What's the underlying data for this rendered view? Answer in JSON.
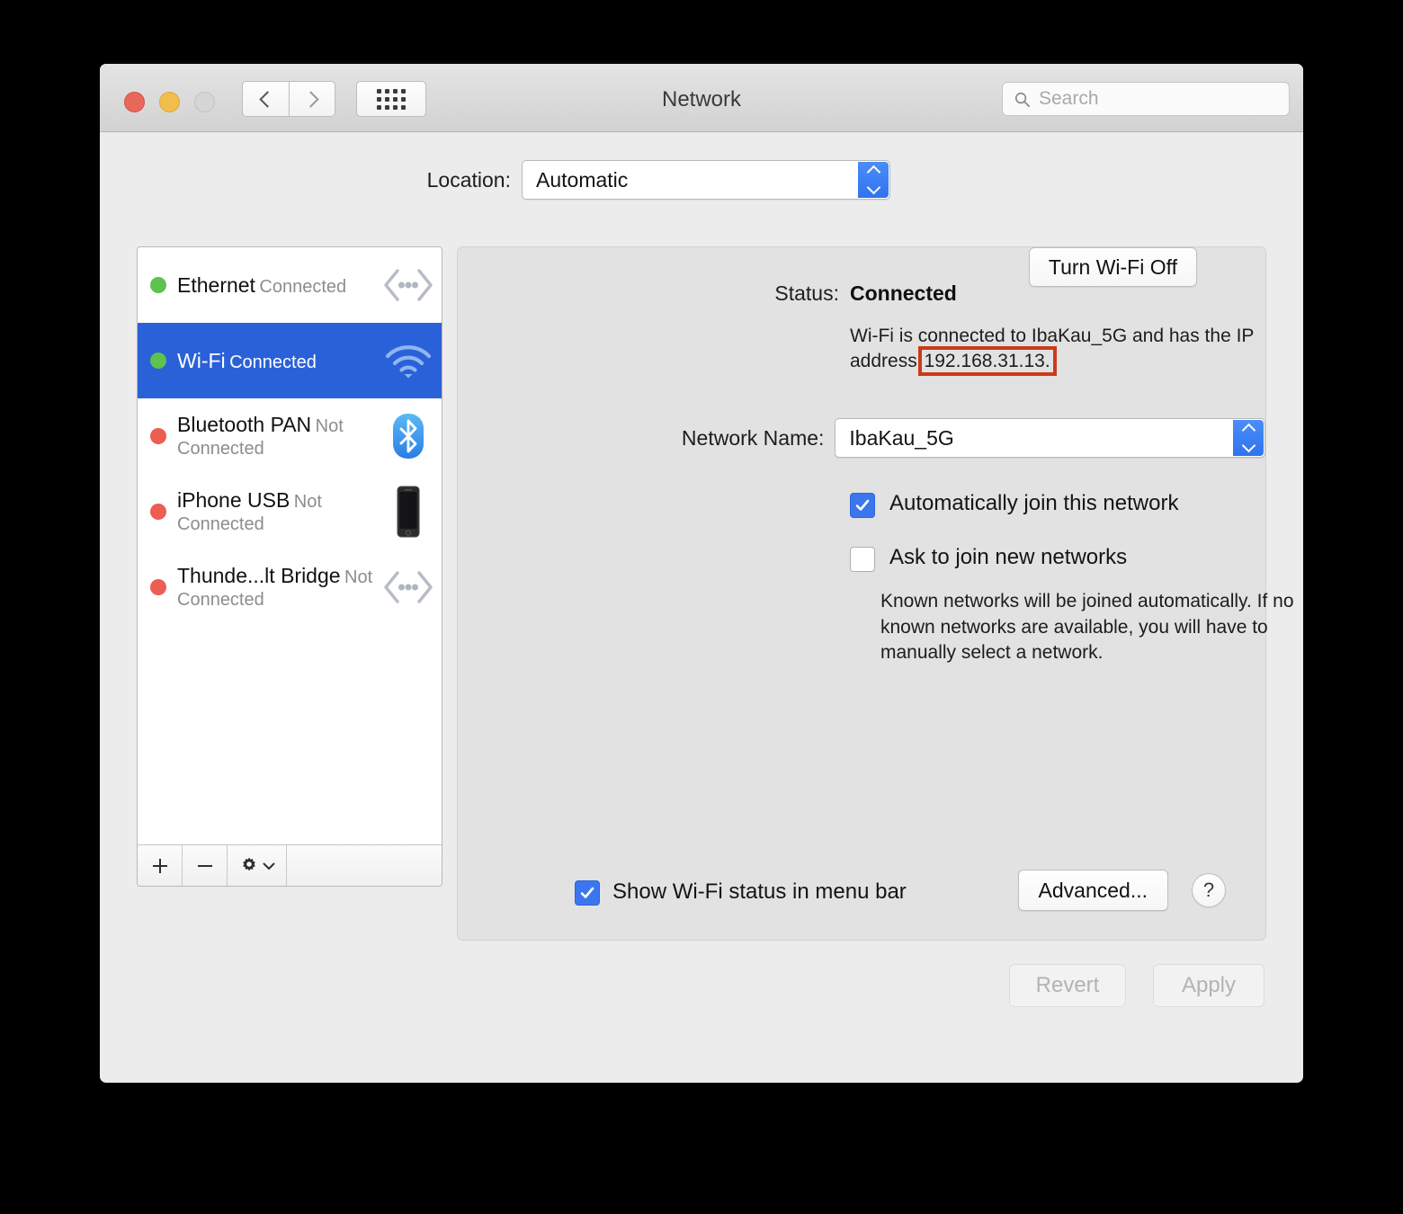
{
  "window": {
    "title": "Network",
    "traffic_lights": [
      "close",
      "minimize",
      "zoom"
    ]
  },
  "toolbar": {
    "back_icon": "chevron-left-icon",
    "forward_icon": "chevron-right-icon",
    "grid_icon": "show-all-grid-icon",
    "search": {
      "placeholder": "Search",
      "value": "",
      "icon": "search-icon"
    }
  },
  "location": {
    "label": "Location:",
    "value": "Automatic",
    "options": [
      "Automatic"
    ]
  },
  "sidebar": {
    "interfaces": [
      {
        "name": "Ethernet",
        "status": "Connected",
        "dot": "green",
        "icon": "ethernet-icon",
        "selected": false
      },
      {
        "name": "Wi-Fi",
        "status": "Connected",
        "dot": "green",
        "icon": "wifi-icon",
        "selected": true
      },
      {
        "name": "Bluetooth PAN",
        "status": "Not Connected",
        "dot": "red",
        "icon": "bluetooth-icon",
        "selected": false
      },
      {
        "name": "iPhone USB",
        "status": "Not Connected",
        "dot": "red",
        "icon": "iphone-icon",
        "selected": false
      },
      {
        "name": "Thunde...lt Bridge",
        "status": "Not Connected",
        "dot": "red",
        "icon": "ethernet-icon",
        "selected": false
      }
    ],
    "toolbar": {
      "add_label": "+",
      "remove_label": "−",
      "gear_icon": "gear-icon",
      "gear_chevron_icon": "chevron-down-icon"
    }
  },
  "panel": {
    "status_label": "Status:",
    "status_value": "Connected",
    "turn_wifi_off_label": "Turn Wi-Fi Off",
    "status_description_before": "Wi-Fi is connected to IbaKau_5G and has the IP address ",
    "status_ip": "192.168.31.13.",
    "network_name_label": "Network Name:",
    "network_name_value": "IbaKau_5G",
    "auto_join_label": "Automatically join this network",
    "auto_join_checked": true,
    "ask_join_label": "Ask to join new networks",
    "ask_join_checked": false,
    "known_networks_note": "Known networks will be joined automatically. If no known networks are available, you will have to manually select a network.",
    "show_status_label": "Show Wi-Fi status in menu bar",
    "show_status_checked": true,
    "advanced_label": "Advanced...",
    "help_label": "?"
  },
  "footer": {
    "revert_label": "Revert",
    "apply_label": "Apply",
    "revert_enabled": false,
    "apply_enabled": false
  },
  "colors": {
    "selection_blue": "#2b61d8",
    "accent_blue": "#3b76ef",
    "connected_green": "#5dc24e",
    "disconnected_red": "#ec5e52",
    "annotation_red": "#cc3a18",
    "window_bg": "#ececec",
    "panel_bg": "#e2e2e2"
  }
}
